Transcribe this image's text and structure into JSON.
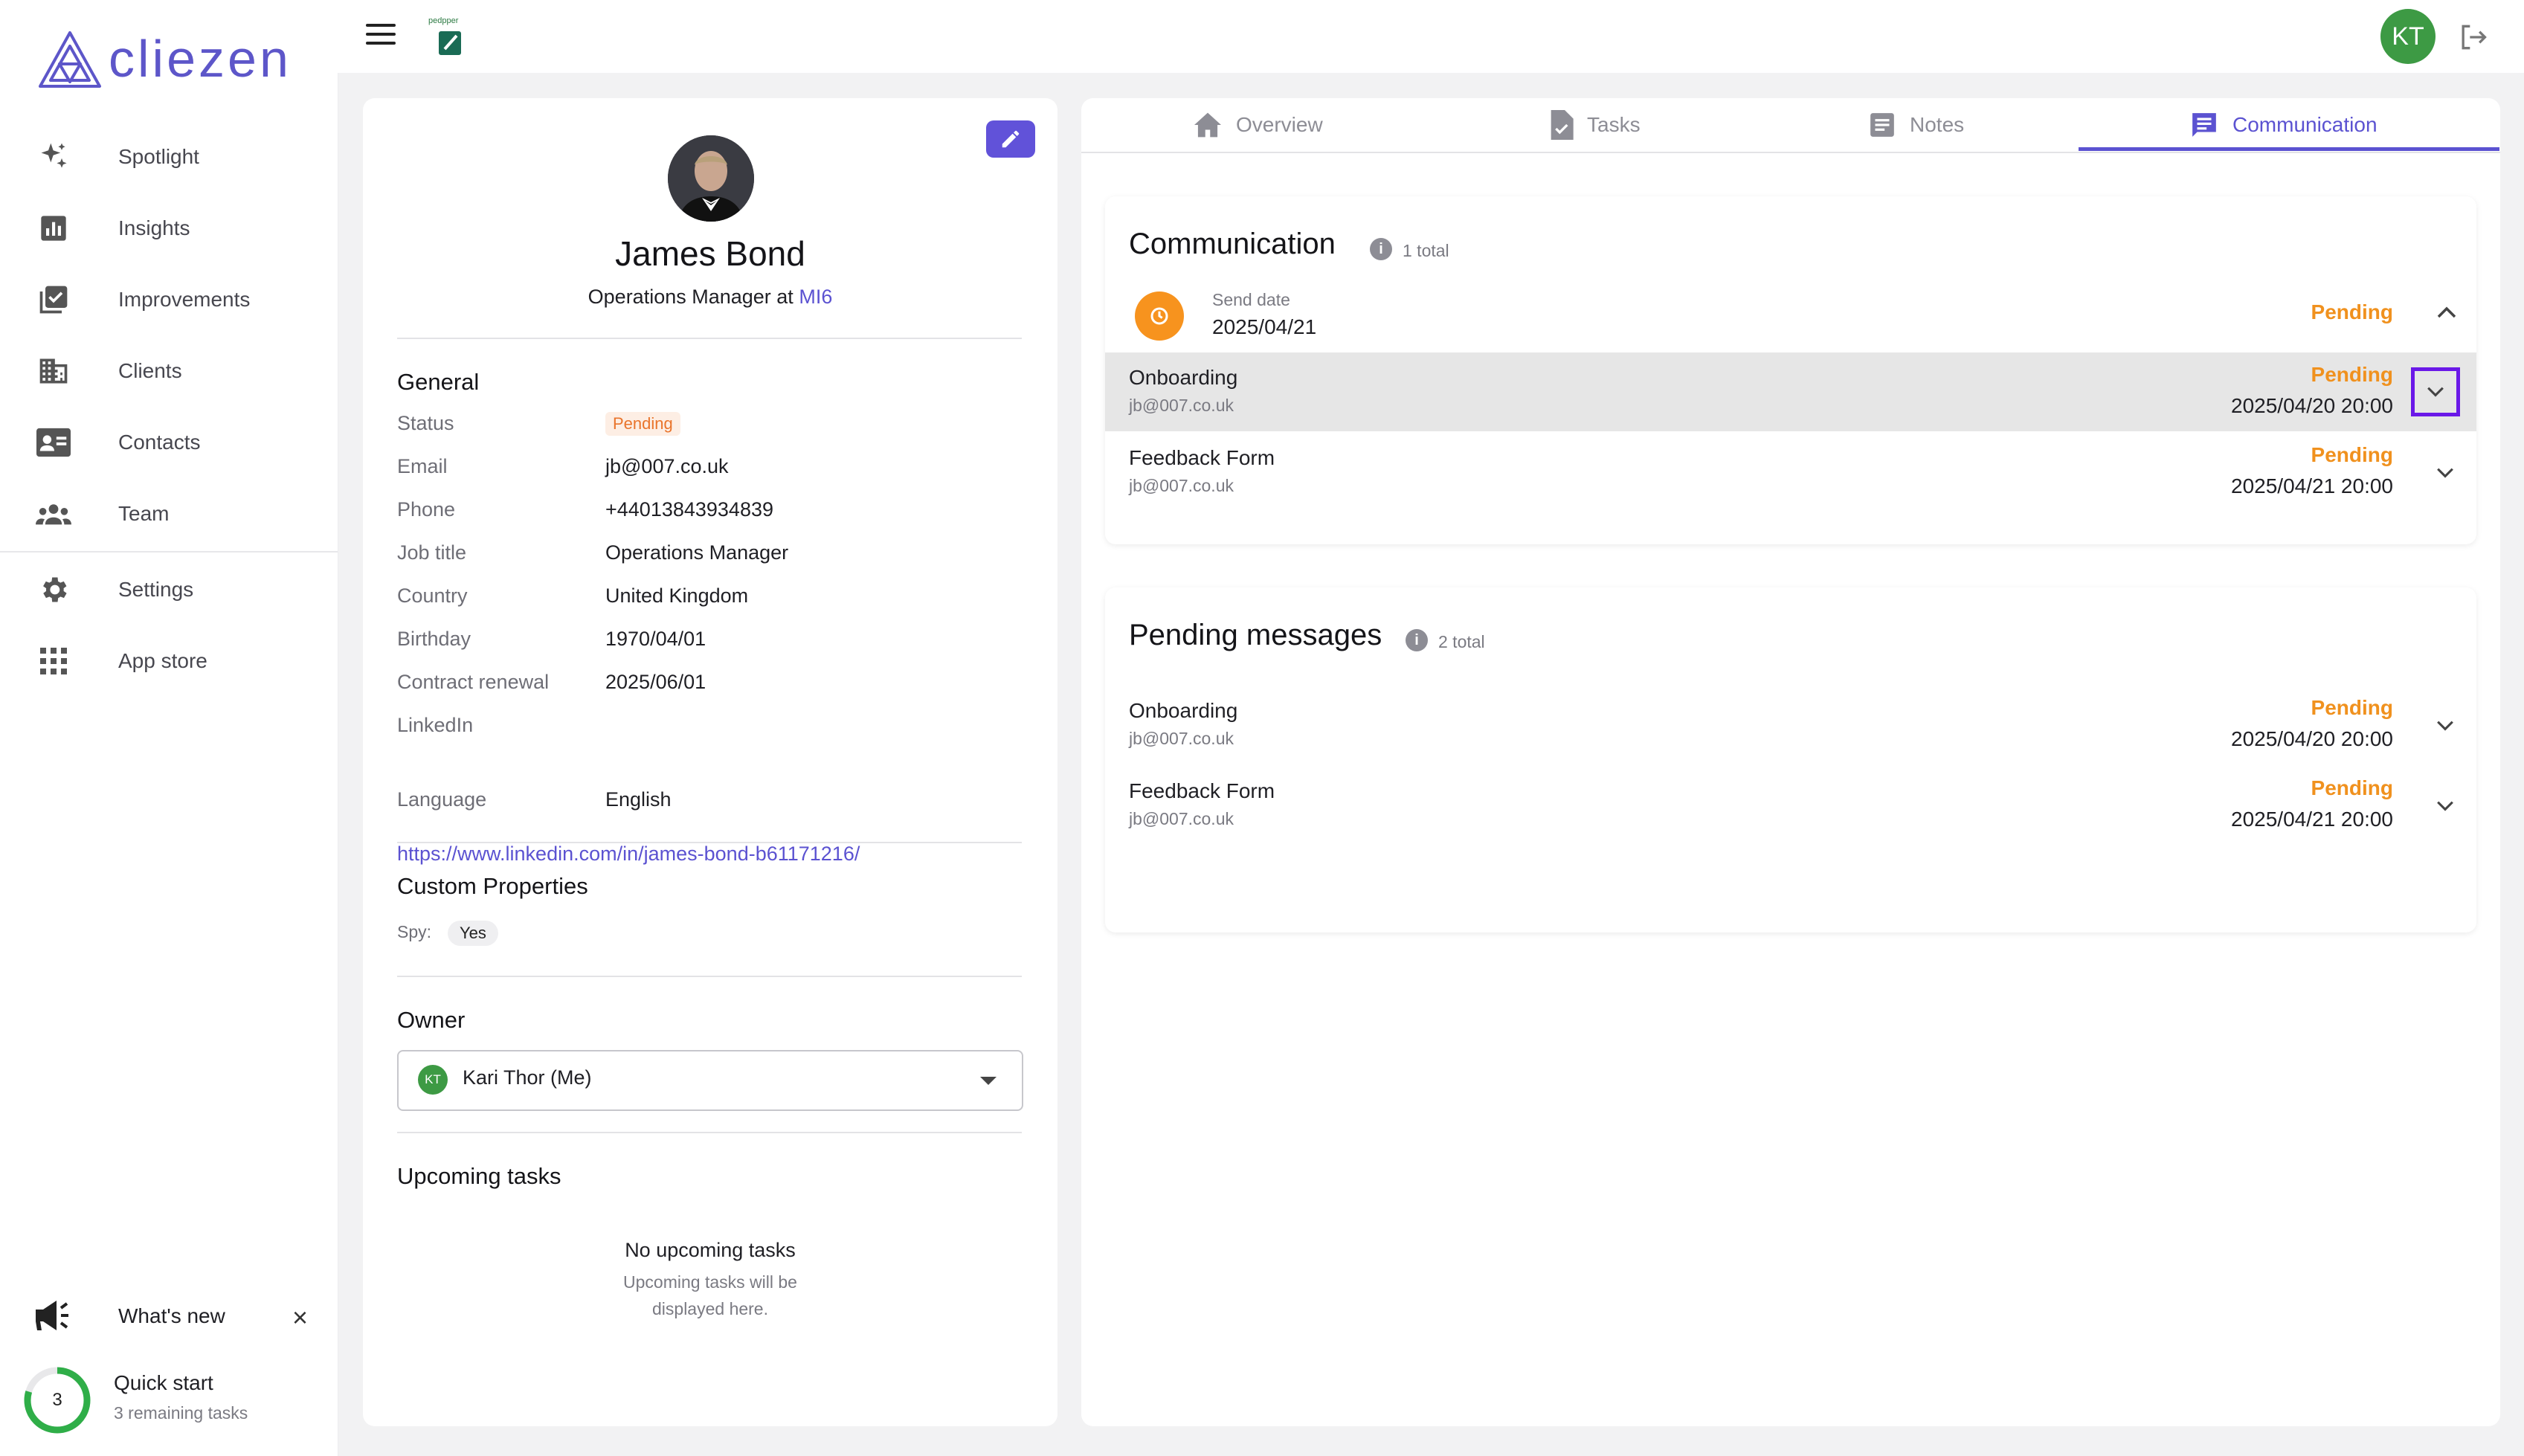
{
  "brand": {
    "name": "cliezen",
    "color": "#5d56c9",
    "partner_logo_text": "pedpper"
  },
  "sidebar": {
    "items": [
      {
        "label": "Spotlight",
        "icon": "sparkles-icon"
      },
      {
        "label": "Insights",
        "icon": "bar-chart-icon"
      },
      {
        "label": "Improvements",
        "icon": "checklist-icon"
      },
      {
        "label": "Clients",
        "icon": "building-icon"
      },
      {
        "label": "Contacts",
        "icon": "contact-card-icon"
      },
      {
        "label": "Team",
        "icon": "group-icon"
      }
    ],
    "secondary_items": [
      {
        "label": "Settings",
        "icon": "gear-icon"
      },
      {
        "label": "App store",
        "icon": "apps-grid-icon"
      }
    ],
    "whats_new": {
      "label": "What's new",
      "close": "×"
    },
    "quick_start": {
      "title": "Quick start",
      "subtitle": "3 remaining tasks",
      "count": "3"
    }
  },
  "topbar": {
    "user_initials": "KT"
  },
  "profile": {
    "name": "James Bond",
    "role_prefix": "Operations Manager at ",
    "organization": "MI6",
    "general": {
      "title": "General",
      "status_label": "Status",
      "status_value": "Pending",
      "email_label": "Email",
      "email_value": "jb@007.co.uk",
      "phone_label": "Phone",
      "phone_value": "+44013843934839",
      "job_label": "Job title",
      "job_value": "Operations Manager",
      "country_label": "Country",
      "country_value": "United Kingdom",
      "birthday_label": "Birthday",
      "birthday_value": "1970/04/01",
      "renewal_label": "Contract renewal",
      "renewal_value": "2025/06/01",
      "linkedin_label": "LinkedIn",
      "linkedin_value": "https://www.linkedin.com/in/james-bond-b61171216/",
      "language_label": "Language",
      "language_value": "English"
    },
    "custom": {
      "title": "Custom Properties",
      "spy_label": "Spy:",
      "spy_value": "Yes"
    },
    "owner": {
      "title": "Owner",
      "initials": "KT",
      "value": "Kari Thor (Me)"
    },
    "upcoming": {
      "title": "Upcoming tasks",
      "empty_title": "No upcoming tasks",
      "empty_sub": "Upcoming tasks will be displayed here."
    }
  },
  "tabs": [
    {
      "label": "Overview",
      "icon": "home-icon"
    },
    {
      "label": "Tasks",
      "icon": "task-doc-icon"
    },
    {
      "label": "Notes",
      "icon": "notes-icon"
    },
    {
      "label": "Communication",
      "icon": "chat-icon"
    }
  ],
  "communication": {
    "title": "Communication",
    "count": "1 total",
    "send_label": "Send date",
    "send_date": "2025/04/21",
    "send_status": "Pending",
    "messages": [
      {
        "title": "Onboarding",
        "email": "jb@007.co.uk",
        "status": "Pending",
        "date": "2025/04/20 20:00"
      },
      {
        "title": "Feedback Form",
        "email": "jb@007.co.uk",
        "status": "Pending",
        "date": "2025/04/21 20:00"
      }
    ]
  },
  "pending": {
    "title": "Pending messages",
    "count": "2 total",
    "messages": [
      {
        "title": "Onboarding",
        "email": "jb@007.co.uk",
        "status": "Pending",
        "date": "2025/04/20 20:00"
      },
      {
        "title": "Feedback Form",
        "email": "jb@007.co.uk",
        "status": "Pending",
        "date": "2025/04/21 20:00"
      }
    ]
  },
  "colors": {
    "accent": "#5b52d1",
    "pending": "#f0911e",
    "owner_avatar": "#3d9a44"
  }
}
